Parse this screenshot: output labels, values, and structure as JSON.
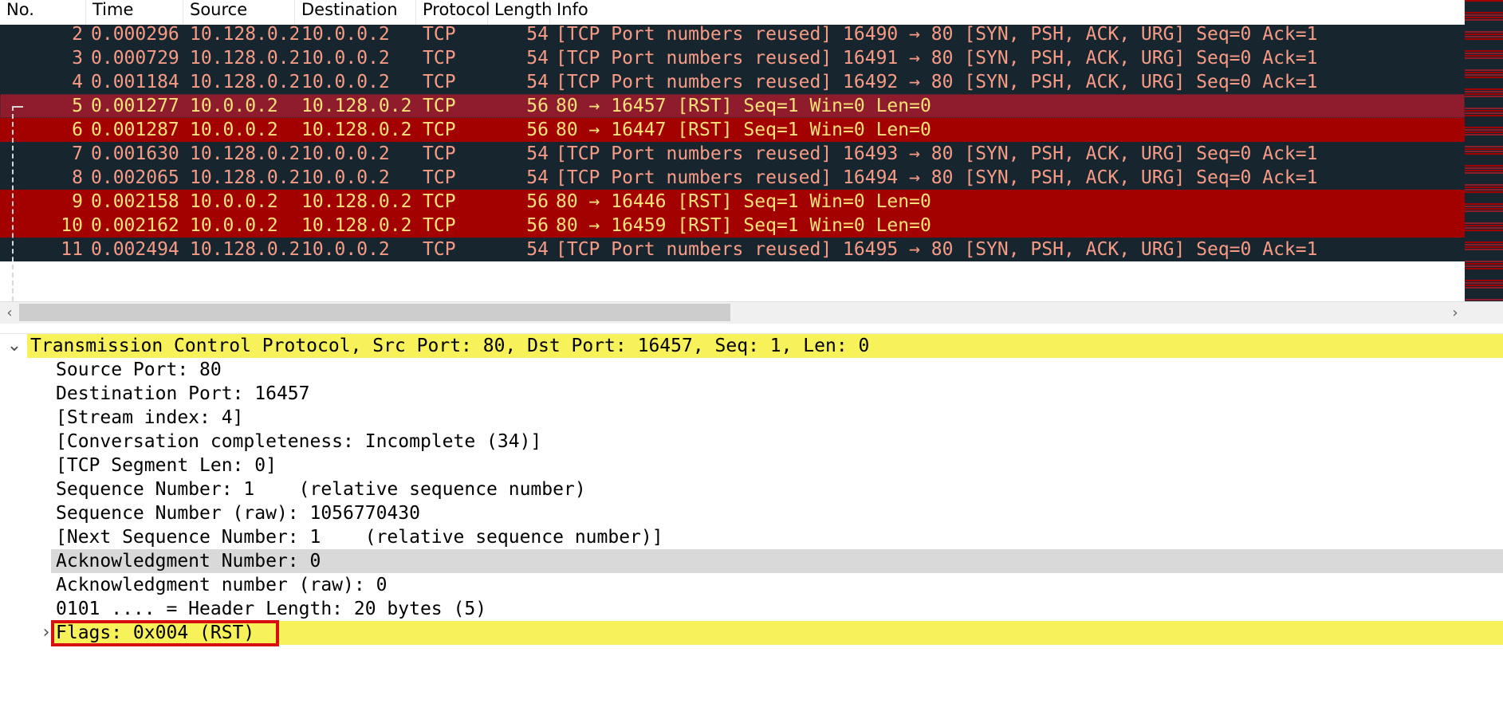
{
  "colors": {
    "row_dark": "#17262e",
    "row_rst_selected": "#8f1c2c",
    "row_rst": "#a30000",
    "row_text": "#f79b86",
    "row_text_rst": "#fde27a",
    "highlight_yellow": "#f7f15a",
    "highlight_gray": "#d9d9d9",
    "annotation_red": "#d80f0f"
  },
  "packet_list": {
    "columns": [
      "No.",
      "Time",
      "Source",
      "Destination",
      "Protocol",
      "Length",
      "Info"
    ],
    "rows": [
      {
        "no": "2",
        "time": "0.000296",
        "src": "10.128.0.2",
        "dst": "10.0.0.2",
        "proto": "TCP",
        "len": "54",
        "info": "[TCP Port numbers reused] 16490 → 80 [SYN, PSH, ACK, URG] Seq=0 Ack=1",
        "style": "dark"
      },
      {
        "no": "3",
        "time": "0.000729",
        "src": "10.128.0.2",
        "dst": "10.0.0.2",
        "proto": "TCP",
        "len": "54",
        "info": "[TCP Port numbers reused] 16491 → 80 [SYN, PSH, ACK, URG] Seq=0 Ack=1",
        "style": "dark"
      },
      {
        "no": "4",
        "time": "0.001184",
        "src": "10.128.0.2",
        "dst": "10.0.0.2",
        "proto": "TCP",
        "len": "54",
        "info": "[TCP Port numbers reused] 16492 → 80 [SYN, PSH, ACK, URG] Seq=0 Ack=1",
        "style": "dark"
      },
      {
        "no": "5",
        "time": "0.001277",
        "src": "10.0.0.2",
        "dst": "10.128.0.2",
        "proto": "TCP",
        "len": "56",
        "info": "80 → 16457 [RST] Seq=1 Win=0 Len=0",
        "style": "rst-selected"
      },
      {
        "no": "6",
        "time": "0.001287",
        "src": "10.0.0.2",
        "dst": "10.128.0.2",
        "proto": "TCP",
        "len": "56",
        "info": "80 → 16447 [RST] Seq=1 Win=0 Len=0",
        "style": "rst"
      },
      {
        "no": "7",
        "time": "0.001630",
        "src": "10.128.0.2",
        "dst": "10.0.0.2",
        "proto": "TCP",
        "len": "54",
        "info": "[TCP Port numbers reused] 16493 → 80 [SYN, PSH, ACK, URG] Seq=0 Ack=1",
        "style": "dark"
      },
      {
        "no": "8",
        "time": "0.002065",
        "src": "10.128.0.2",
        "dst": "10.0.0.2",
        "proto": "TCP",
        "len": "54",
        "info": "[TCP Port numbers reused] 16494 → 80 [SYN, PSH, ACK, URG] Seq=0 Ack=1",
        "style": "dark"
      },
      {
        "no": "9",
        "time": "0.002158",
        "src": "10.0.0.2",
        "dst": "10.128.0.2",
        "proto": "TCP",
        "len": "56",
        "info": "80 → 16446 [RST] Seq=1 Win=0 Len=0",
        "style": "rst"
      },
      {
        "no": "10",
        "time": "0.002162",
        "src": "10.0.0.2",
        "dst": "10.128.0.2",
        "proto": "TCP",
        "len": "56",
        "info": "80 → 16459 [RST] Seq=1 Win=0 Len=0",
        "style": "rst"
      },
      {
        "no": "11",
        "time": "0.002494",
        "src": "10.128.0.2",
        "dst": "10.0.0.2",
        "proto": "TCP",
        "len": "54",
        "info": "[TCP Port numbers reused] 16495 → 80 [SYN, PSH, ACK, URG] Seq=0 Ack=1",
        "style": "dark"
      }
    ]
  },
  "scrollbar": {
    "left_icon": "chevron-left-icon",
    "right_icon": "chevron-right-icon",
    "left_glyph": "‹",
    "right_glyph": "›"
  },
  "details": {
    "expanded_icon": "chevron-down-icon",
    "collapsed_icon": "chevron-right-icon",
    "expanded_glyph": "⌄",
    "collapsed_glyph": "›",
    "lines": [
      {
        "text": "Transmission Control Protocol, Src Port: 80, Dst Port: 16457, Seq: 1, Len: 0",
        "level": 0,
        "twisty": "expanded",
        "highlight": "yellow"
      },
      {
        "text": "Source Port: 80",
        "level": 1,
        "twisty": "",
        "highlight": ""
      },
      {
        "text": "Destination Port: 16457",
        "level": 1,
        "twisty": "",
        "highlight": ""
      },
      {
        "text": "[Stream index: 4]",
        "level": 1,
        "twisty": "",
        "highlight": ""
      },
      {
        "text": "[Conversation completeness: Incomplete (34)]",
        "level": 1,
        "twisty": "",
        "highlight": ""
      },
      {
        "text": "[TCP Segment Len: 0]",
        "level": 1,
        "twisty": "",
        "highlight": ""
      },
      {
        "text": "Sequence Number: 1    (relative sequence number)",
        "level": 1,
        "twisty": "",
        "highlight": ""
      },
      {
        "text": "Sequence Number (raw): 1056770430",
        "level": 1,
        "twisty": "",
        "highlight": ""
      },
      {
        "text": "[Next Sequence Number: 1    (relative sequence number)]",
        "level": 1,
        "twisty": "",
        "highlight": ""
      },
      {
        "text": "Acknowledgment Number: 0",
        "level": 1,
        "twisty": "",
        "highlight": "gray"
      },
      {
        "text": "Acknowledgment number (raw): 0",
        "level": 1,
        "twisty": "",
        "highlight": ""
      },
      {
        "text": "0101 .... = Header Length: 20 bytes (5)",
        "level": 1,
        "twisty": "",
        "highlight": ""
      },
      {
        "text": "Flags: 0x004 (RST)",
        "level": 1,
        "twisty": "collapsed",
        "highlight": "yellow",
        "boxed": true
      }
    ]
  }
}
